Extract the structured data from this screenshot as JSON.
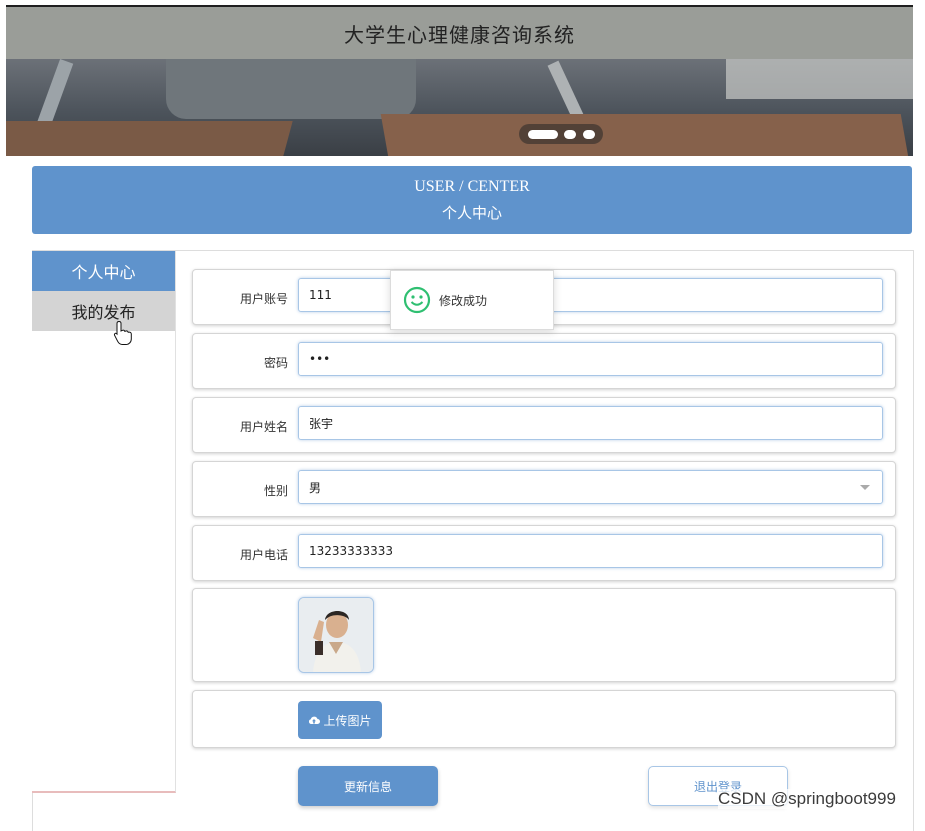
{
  "header": {
    "title": "大学生心理健康咨询系统"
  },
  "center_banner": {
    "en": "USER / CENTER",
    "cn": "个人中心"
  },
  "sidebar": {
    "items": [
      {
        "label": "个人中心"
      },
      {
        "label": "我的发布"
      }
    ]
  },
  "form": {
    "username": {
      "label": "用户账号",
      "value": "111"
    },
    "password": {
      "label": "密码",
      "value": "•••"
    },
    "name": {
      "label": "用户姓名",
      "value": "张宇"
    },
    "gender": {
      "label": "性别",
      "value": "男"
    },
    "phone": {
      "label": "用户电话",
      "value": "13233333333"
    },
    "upload_label": "上传图片",
    "update_label": "更新信息",
    "logout_label": "退出登录"
  },
  "toast": {
    "message": "修改成功"
  },
  "watermark": "CSDN @springboot999",
  "colors": {
    "accent": "#5f93cc",
    "title_bar": "#9a9d98",
    "success": "#2fbf71"
  }
}
